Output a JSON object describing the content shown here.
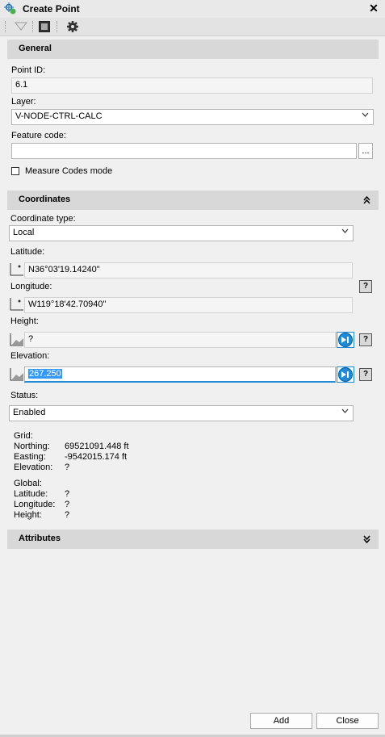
{
  "window": {
    "title": "Create Point",
    "close_glyph": "✕"
  },
  "general": {
    "header": "General",
    "point_id_label": "Point ID:",
    "point_id_value": "6.1",
    "layer_label": "Layer:",
    "layer_value": "V-NODE-CTRL-CALC",
    "feature_code_label": "Feature code:",
    "feature_code_value": "",
    "browse_label": "...",
    "measure_codes_label": "Measure Codes mode"
  },
  "coordinates": {
    "header": "Coordinates",
    "coord_type_label": "Coordinate type:",
    "coord_type_value": "Local",
    "latitude_label": "Latitude:",
    "latitude_value": "N36°03'19.14240\"",
    "longitude_label": "Longitude:",
    "longitude_value": "W119°18'42.70940\"",
    "height_label": "Height:",
    "height_value": "?",
    "elevation_label": "Elevation:",
    "elevation_value": "267.250",
    "status_label": "Status:",
    "status_value": "Enabled",
    "help_glyph": "?"
  },
  "grid": {
    "label": "Grid:",
    "northing_label": "Northing:",
    "northing_value": "69521091.448 ft",
    "easting_label": "Easting:",
    "easting_value": "-9542015.174 ft",
    "elevation_label": "Elevation:",
    "elevation_value": "?"
  },
  "global": {
    "label": "Global:",
    "latitude_label": "Latitude:",
    "latitude_value": "?",
    "longitude_label": "Longitude:",
    "longitude_value": "?",
    "height_label": "Height:",
    "height_value": "?"
  },
  "attributes": {
    "header": "Attributes"
  },
  "footer": {
    "add_label": "Add",
    "close_label": "Close"
  },
  "colors": {
    "accent": "#1f8ad6",
    "section_bg": "#d8d8d8",
    "selection": "#3399ff"
  }
}
